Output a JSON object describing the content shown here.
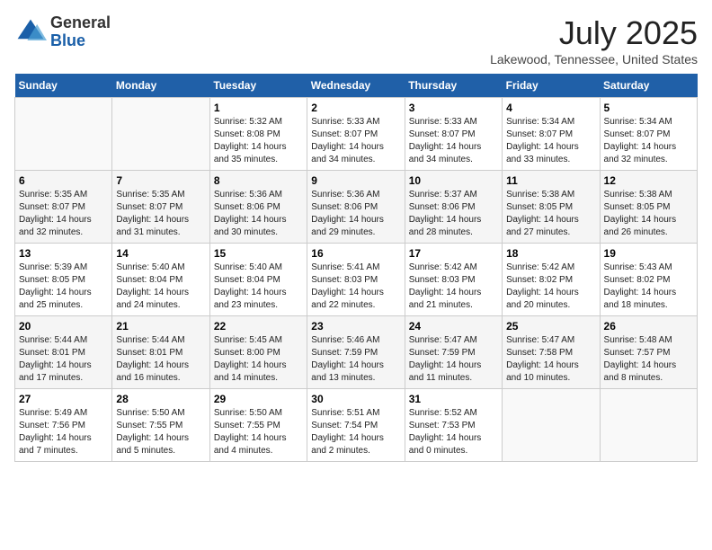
{
  "logo": {
    "general": "General",
    "blue": "Blue"
  },
  "title": "July 2025",
  "location": "Lakewood, Tennessee, United States",
  "days_of_week": [
    "Sunday",
    "Monday",
    "Tuesday",
    "Wednesday",
    "Thursday",
    "Friday",
    "Saturday"
  ],
  "weeks": [
    [
      {
        "day": "",
        "sunrise": "",
        "sunset": "",
        "daylight": ""
      },
      {
        "day": "",
        "sunrise": "",
        "sunset": "",
        "daylight": ""
      },
      {
        "day": "1",
        "sunrise": "Sunrise: 5:32 AM",
        "sunset": "Sunset: 8:08 PM",
        "daylight": "Daylight: 14 hours and 35 minutes."
      },
      {
        "day": "2",
        "sunrise": "Sunrise: 5:33 AM",
        "sunset": "Sunset: 8:07 PM",
        "daylight": "Daylight: 14 hours and 34 minutes."
      },
      {
        "day": "3",
        "sunrise": "Sunrise: 5:33 AM",
        "sunset": "Sunset: 8:07 PM",
        "daylight": "Daylight: 14 hours and 34 minutes."
      },
      {
        "day": "4",
        "sunrise": "Sunrise: 5:34 AM",
        "sunset": "Sunset: 8:07 PM",
        "daylight": "Daylight: 14 hours and 33 minutes."
      },
      {
        "day": "5",
        "sunrise": "Sunrise: 5:34 AM",
        "sunset": "Sunset: 8:07 PM",
        "daylight": "Daylight: 14 hours and 32 minutes."
      }
    ],
    [
      {
        "day": "6",
        "sunrise": "Sunrise: 5:35 AM",
        "sunset": "Sunset: 8:07 PM",
        "daylight": "Daylight: 14 hours and 32 minutes."
      },
      {
        "day": "7",
        "sunrise": "Sunrise: 5:35 AM",
        "sunset": "Sunset: 8:07 PM",
        "daylight": "Daylight: 14 hours and 31 minutes."
      },
      {
        "day": "8",
        "sunrise": "Sunrise: 5:36 AM",
        "sunset": "Sunset: 8:06 PM",
        "daylight": "Daylight: 14 hours and 30 minutes."
      },
      {
        "day": "9",
        "sunrise": "Sunrise: 5:36 AM",
        "sunset": "Sunset: 8:06 PM",
        "daylight": "Daylight: 14 hours and 29 minutes."
      },
      {
        "day": "10",
        "sunrise": "Sunrise: 5:37 AM",
        "sunset": "Sunset: 8:06 PM",
        "daylight": "Daylight: 14 hours and 28 minutes."
      },
      {
        "day": "11",
        "sunrise": "Sunrise: 5:38 AM",
        "sunset": "Sunset: 8:05 PM",
        "daylight": "Daylight: 14 hours and 27 minutes."
      },
      {
        "day": "12",
        "sunrise": "Sunrise: 5:38 AM",
        "sunset": "Sunset: 8:05 PM",
        "daylight": "Daylight: 14 hours and 26 minutes."
      }
    ],
    [
      {
        "day": "13",
        "sunrise": "Sunrise: 5:39 AM",
        "sunset": "Sunset: 8:05 PM",
        "daylight": "Daylight: 14 hours and 25 minutes."
      },
      {
        "day": "14",
        "sunrise": "Sunrise: 5:40 AM",
        "sunset": "Sunset: 8:04 PM",
        "daylight": "Daylight: 14 hours and 24 minutes."
      },
      {
        "day": "15",
        "sunrise": "Sunrise: 5:40 AM",
        "sunset": "Sunset: 8:04 PM",
        "daylight": "Daylight: 14 hours and 23 minutes."
      },
      {
        "day": "16",
        "sunrise": "Sunrise: 5:41 AM",
        "sunset": "Sunset: 8:03 PM",
        "daylight": "Daylight: 14 hours and 22 minutes."
      },
      {
        "day": "17",
        "sunrise": "Sunrise: 5:42 AM",
        "sunset": "Sunset: 8:03 PM",
        "daylight": "Daylight: 14 hours and 21 minutes."
      },
      {
        "day": "18",
        "sunrise": "Sunrise: 5:42 AM",
        "sunset": "Sunset: 8:02 PM",
        "daylight": "Daylight: 14 hours and 20 minutes."
      },
      {
        "day": "19",
        "sunrise": "Sunrise: 5:43 AM",
        "sunset": "Sunset: 8:02 PM",
        "daylight": "Daylight: 14 hours and 18 minutes."
      }
    ],
    [
      {
        "day": "20",
        "sunrise": "Sunrise: 5:44 AM",
        "sunset": "Sunset: 8:01 PM",
        "daylight": "Daylight: 14 hours and 17 minutes."
      },
      {
        "day": "21",
        "sunrise": "Sunrise: 5:44 AM",
        "sunset": "Sunset: 8:01 PM",
        "daylight": "Daylight: 14 hours and 16 minutes."
      },
      {
        "day": "22",
        "sunrise": "Sunrise: 5:45 AM",
        "sunset": "Sunset: 8:00 PM",
        "daylight": "Daylight: 14 hours and 14 minutes."
      },
      {
        "day": "23",
        "sunrise": "Sunrise: 5:46 AM",
        "sunset": "Sunset: 7:59 PM",
        "daylight": "Daylight: 14 hours and 13 minutes."
      },
      {
        "day": "24",
        "sunrise": "Sunrise: 5:47 AM",
        "sunset": "Sunset: 7:59 PM",
        "daylight": "Daylight: 14 hours and 11 minutes."
      },
      {
        "day": "25",
        "sunrise": "Sunrise: 5:47 AM",
        "sunset": "Sunset: 7:58 PM",
        "daylight": "Daylight: 14 hours and 10 minutes."
      },
      {
        "day": "26",
        "sunrise": "Sunrise: 5:48 AM",
        "sunset": "Sunset: 7:57 PM",
        "daylight": "Daylight: 14 hours and 8 minutes."
      }
    ],
    [
      {
        "day": "27",
        "sunrise": "Sunrise: 5:49 AM",
        "sunset": "Sunset: 7:56 PM",
        "daylight": "Daylight: 14 hours and 7 minutes."
      },
      {
        "day": "28",
        "sunrise": "Sunrise: 5:50 AM",
        "sunset": "Sunset: 7:55 PM",
        "daylight": "Daylight: 14 hours and 5 minutes."
      },
      {
        "day": "29",
        "sunrise": "Sunrise: 5:50 AM",
        "sunset": "Sunset: 7:55 PM",
        "daylight": "Daylight: 14 hours and 4 minutes."
      },
      {
        "day": "30",
        "sunrise": "Sunrise: 5:51 AM",
        "sunset": "Sunset: 7:54 PM",
        "daylight": "Daylight: 14 hours and 2 minutes."
      },
      {
        "day": "31",
        "sunrise": "Sunrise: 5:52 AM",
        "sunset": "Sunset: 7:53 PM",
        "daylight": "Daylight: 14 hours and 0 minutes."
      },
      {
        "day": "",
        "sunrise": "",
        "sunset": "",
        "daylight": ""
      },
      {
        "day": "",
        "sunrise": "",
        "sunset": "",
        "daylight": ""
      }
    ]
  ]
}
